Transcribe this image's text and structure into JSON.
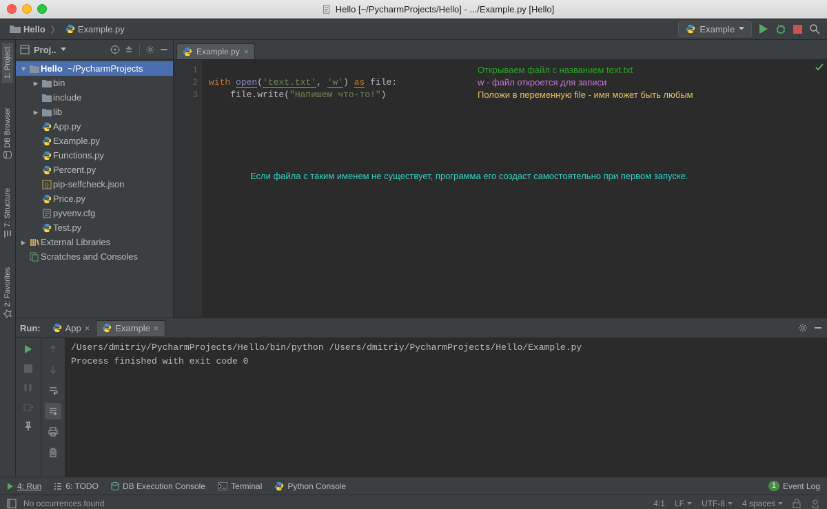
{
  "window": {
    "title": "Hello [~/PycharmProjects/Hello] - .../Example.py [Hello]"
  },
  "breadcrumbs": {
    "project": "Hello",
    "file": "Example.py"
  },
  "toolbar": {
    "run_config": "Example"
  },
  "project": {
    "panel_title": "Proj..",
    "root": {
      "name": "Hello",
      "path": "~/PycharmProjects"
    },
    "folders": [
      "bin",
      "include",
      "lib"
    ],
    "files": [
      "App.py",
      "Example.py",
      "Functions.py",
      "Percent.py",
      "pip-selfcheck.json",
      "Price.py",
      "pyvenv.cfg",
      "Test.py"
    ],
    "external": "External Libraries",
    "scratches": "Scratches and Consoles"
  },
  "editor": {
    "tab": "Example.py",
    "lines": [
      "1",
      "2",
      "3"
    ],
    "code": {
      "l1": {
        "a": "with",
        "b": "open",
        "c": "(",
        "d": "'text.txt'",
        "e": ", ",
        "f": "'w'",
        "g": ") ",
        "h": "as",
        "i": " file:"
      },
      "l2": {
        "a": "    file.write(",
        "b": "\"Напишем что-то!\"",
        "c": ")"
      }
    },
    "annotations": {
      "a1": "Открываем файл с названием text.txt",
      "a2": "w - файл откроется для записи",
      "a3": "Положи в переменную file - имя может быть любым",
      "a4": "Если файла с таким именем не существует, программа его создаст самостоятельно при первом запуске."
    }
  },
  "run": {
    "label": "Run:",
    "tabs": [
      "App",
      "Example"
    ],
    "console": {
      "line1": "/Users/dmitriy/PycharmProjects/Hello/bin/python /Users/dmitriy/PycharmProjects/Hello/Example.py",
      "line2": "",
      "line3": "Process finished with exit code 0"
    }
  },
  "toolstrip": {
    "t1": "4: Run",
    "t2": "6: TODO",
    "t3": "DB Execution Console",
    "t4": "Terminal",
    "t5": "Python Console",
    "event_count": "1",
    "event_label": "Event Log"
  },
  "left_tabs": {
    "project": "1: Project",
    "db": "DB Browser",
    "structure": "7: Structure",
    "favorites": "2: Favorites"
  },
  "status": {
    "msg": "No occurrences found",
    "pos": "4:1",
    "le": "LF",
    "enc": "UTF-8",
    "indent": "4 spaces"
  }
}
